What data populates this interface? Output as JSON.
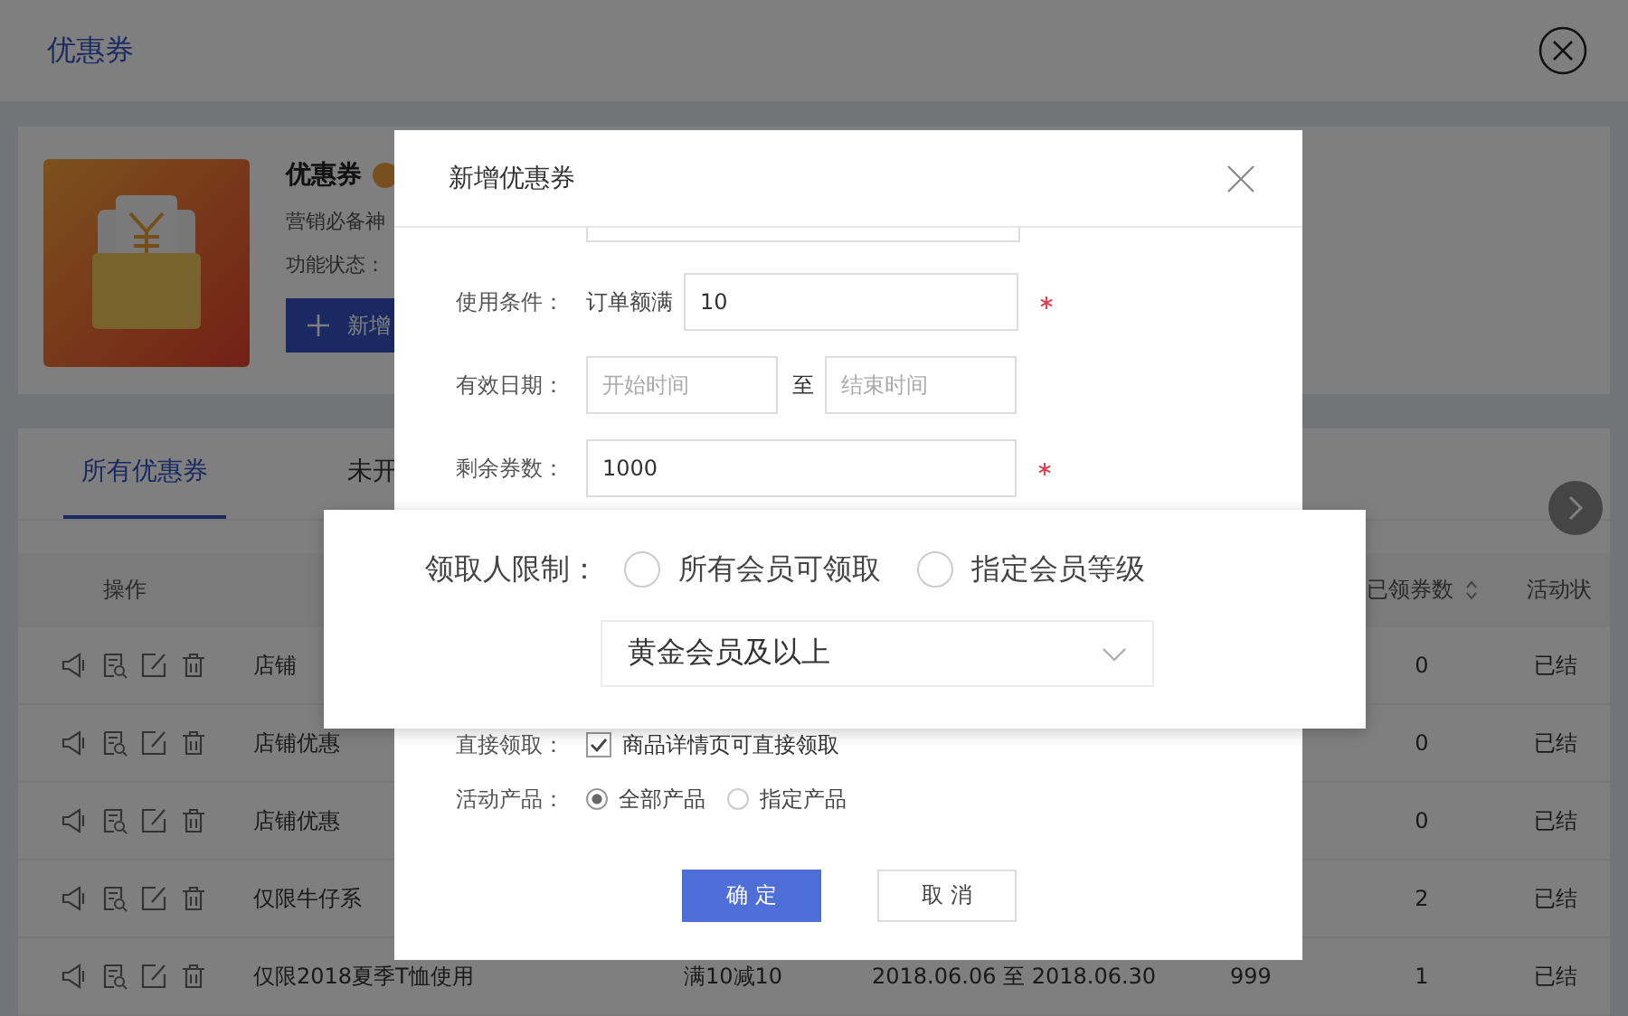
{
  "page": {
    "title": "优惠券"
  },
  "intro": {
    "name": "优惠券",
    "description": "营销必备神",
    "status_label": "功能状态：",
    "add_button": "新增"
  },
  "tabs": [
    {
      "label": "所有优惠券",
      "selected": true
    },
    {
      "label": "未开",
      "selected": false
    }
  ],
  "table": {
    "columns": [
      {
        "label": "操作",
        "sortable": false
      },
      {
        "label": "已领券数",
        "sortable": true
      },
      {
        "label": "活动状",
        "sortable": false
      }
    ],
    "rows": [
      {
        "name": "店铺",
        "claimed": "0",
        "status": "已结"
      },
      {
        "name": "店铺优惠",
        "claimed": "0",
        "status": "已结"
      },
      {
        "name": "店铺优惠",
        "claimed": "0",
        "status": "已结"
      },
      {
        "name": "仅限牛仔系",
        "claimed": "2",
        "status": "已结"
      },
      {
        "name": "仅限2018夏季T恤使用",
        "rule": "满10减10",
        "dates": "2018.06.06 至 2018.06.30",
        "stock": "999",
        "claimed": "1",
        "status": "已结"
      }
    ]
  },
  "dialog": {
    "title": "新增优惠券",
    "fields": [
      {
        "kind": "prefixed_input",
        "label": "使用条件：",
        "prefix": "订单额满",
        "value": "10",
        "required": true
      },
      {
        "kind": "date_range",
        "label": "有效日期：",
        "start_placeholder": "开始时间",
        "separator": "至",
        "end_placeholder": "结束时间",
        "required": false
      },
      {
        "kind": "input",
        "label": "剩余券数：",
        "value": "1000",
        "required": true
      },
      {
        "kind": "checkbox",
        "label": "直接领取：",
        "option": "商品详情页可直接领取",
        "checked": true
      },
      {
        "kind": "radio",
        "label": "活动产品：",
        "options": [
          {
            "label": "全部产品",
            "selected": true
          },
          {
            "label": "指定产品",
            "selected": false
          }
        ]
      }
    ],
    "buttons": [
      {
        "label": "确 定",
        "primary": true
      },
      {
        "label": "取 消",
        "primary": false
      }
    ]
  },
  "callout": {
    "label": "领取人限制：",
    "options": [
      {
        "label": "所有会员可领取",
        "selected": false
      },
      {
        "label": "指定会员等级",
        "selected": false
      }
    ],
    "select": {
      "value": "黄金会员及以上"
    }
  }
}
